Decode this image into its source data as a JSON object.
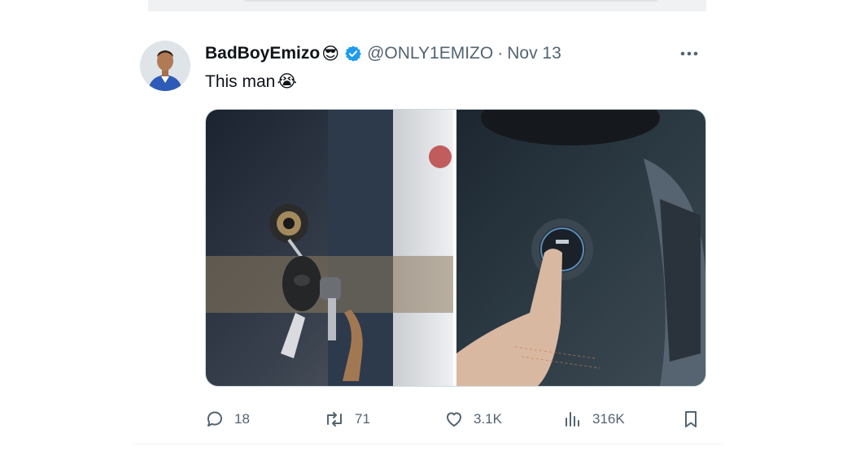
{
  "tweet": {
    "author": {
      "display_name": "BadBoyEmizo",
      "name_emoji": "😎",
      "handle": "@ONLY1EMIZO",
      "verified": true,
      "verified_color": "#1d9bf0"
    },
    "separator": "·",
    "date": "Nov 13",
    "text": "This man",
    "text_emoji": "😭",
    "media": [
      {
        "description_icon": "car-key-ignition-photo"
      },
      {
        "description_icon": "push-start-button-photo"
      }
    ],
    "stats": {
      "replies": "18",
      "reposts": "71",
      "likes": "3.1K",
      "views": "316K"
    }
  },
  "colors": {
    "text_primary": "#0f1419",
    "text_secondary": "#536471",
    "accent": "#1d9bf0"
  }
}
